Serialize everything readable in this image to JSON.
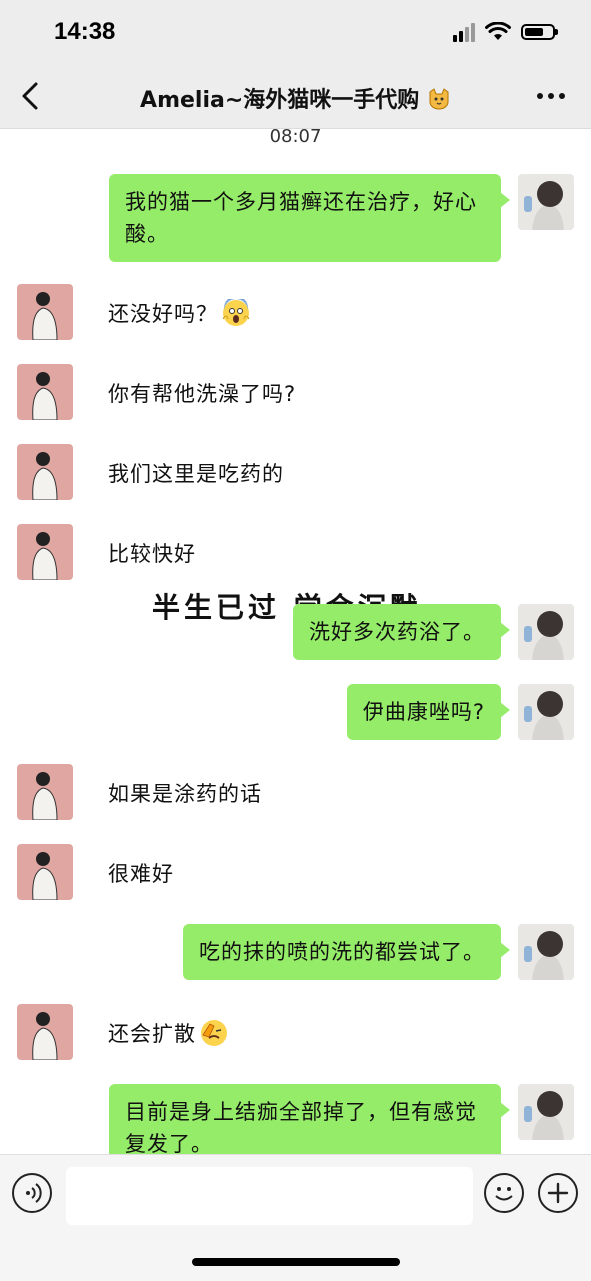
{
  "status": {
    "time": "14:38"
  },
  "nav": {
    "title": "Amelia~海外猫咪一手代购",
    "title_emoji": "cat-face-icon"
  },
  "chat": {
    "timestamp": "08:07",
    "watermark": "半生已过 学会沉默",
    "messages": [
      {
        "side": "out",
        "text": "我的猫一个多月猫癣还在治疗，好心酸。"
      },
      {
        "side": "in",
        "text": "还没好吗？",
        "emoji": "screaming-face-icon"
      },
      {
        "side": "in",
        "text": "你有帮他洗澡了吗?"
      },
      {
        "side": "in",
        "text": "我们这里是吃药的"
      },
      {
        "side": "in",
        "text": "比较快好"
      },
      {
        "side": "out",
        "text": "洗好多次药浴了。"
      },
      {
        "side": "out",
        "text": "伊曲康唑吗?"
      },
      {
        "side": "in",
        "text": "如果是涂药的话"
      },
      {
        "side": "in",
        "text": "很难好"
      },
      {
        "side": "out",
        "text": "吃的抹的喷的洗的都尝试了。"
      },
      {
        "side": "in",
        "text": "还会扩散",
        "emoji": "face-palm-icon"
      },
      {
        "side": "out",
        "text": "目前是身上结痂全部掉了，但有感觉复发了。"
      }
    ]
  },
  "input": {
    "value": "",
    "placeholder": ""
  },
  "colors": {
    "outgoing_bubble": "#95ec69",
    "nav_bg": "#ededed",
    "chat_bg": "#ffffff"
  }
}
